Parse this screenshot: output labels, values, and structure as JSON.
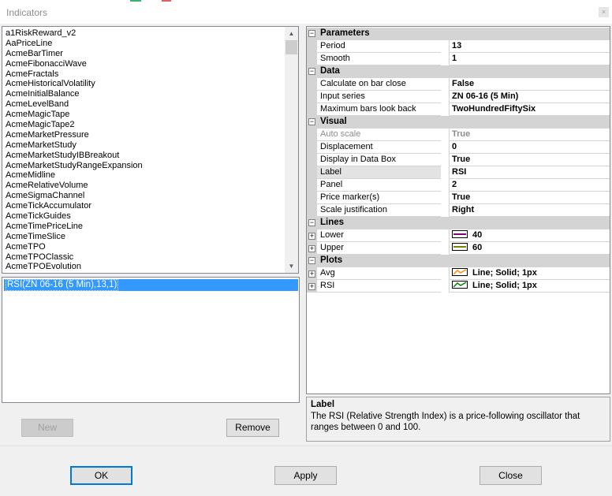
{
  "window": {
    "title": "Indicators",
    "close_glyph": "×"
  },
  "indicator_list": {
    "items": [
      "a1RiskReward_v2",
      "AaPriceLine",
      "AcmeBarTimer",
      "AcmeFibonacciWave",
      "AcmeFractals",
      "AcmeHistoricalVolatility",
      "AcmeInitialBalance",
      "AcmeLevelBand",
      "AcmeMagicTape",
      "AcmeMagicTape2",
      "AcmeMarketPressure",
      "AcmeMarketStudy",
      "AcmeMarketStudyIBBreakout",
      "AcmeMarketStudyRangeExpansion",
      "AcmeMidline",
      "AcmeRelativeVolume",
      "AcmeSigmaChannel",
      "AcmeTickAccumulator",
      "AcmeTickGuides",
      "AcmeTimePriceLine",
      "AcmeTimeSlice",
      "AcmeTPO",
      "AcmeTPOClassic",
      "AcmeTPOEvolution"
    ]
  },
  "applied_list": {
    "selected": "RSI(ZN 06-16 (5 Min),13,1)"
  },
  "buttons": {
    "new": "New",
    "remove": "Remove",
    "ok": "OK",
    "apply": "Apply",
    "close": "Close"
  },
  "properties": {
    "parameters": {
      "label": "Parameters",
      "period_name": "Period",
      "period_value": "13",
      "smooth_name": "Smooth",
      "smooth_value": "1"
    },
    "data": {
      "label": "Data",
      "calc_name": "Calculate on bar close",
      "calc_value": "False",
      "input_name": "Input series",
      "input_value": "ZN 06-16 (5 Min)",
      "maxbars_name": "Maximum bars look back",
      "maxbars_value": "TwoHundredFiftySix"
    },
    "visual": {
      "label": "Visual",
      "autoscale_name": "Auto scale",
      "autoscale_value": "True",
      "displacement_name": "Displacement",
      "displacement_value": "0",
      "databox_name": "Display in Data Box",
      "databox_value": "True",
      "label_name": "Label",
      "label_value": "RSI",
      "panel_name": "Panel",
      "panel_value": "2",
      "pricemarker_name": "Price marker(s)",
      "pricemarker_value": "True",
      "scalejust_name": "Scale justification",
      "scalejust_value": "Right"
    },
    "lines": {
      "label": "Lines",
      "lower_name": "Lower",
      "lower_value": "40",
      "lower_color": "#800080",
      "upper_name": "Upper",
      "upper_value": "60",
      "upper_color": "#808000"
    },
    "plots": {
      "label": "Plots",
      "avg_name": "Avg",
      "avg_value": "Line; Solid; 1px",
      "avg_color": "#ff8c00",
      "rsi_name": "RSI",
      "rsi_value": "Line; Solid; 1px",
      "rsi_color": "#008000"
    }
  },
  "description": {
    "title": "Label",
    "text": "The RSI (Relative Strength Index) is a price-following oscillator that ranges between 0 and 100."
  }
}
